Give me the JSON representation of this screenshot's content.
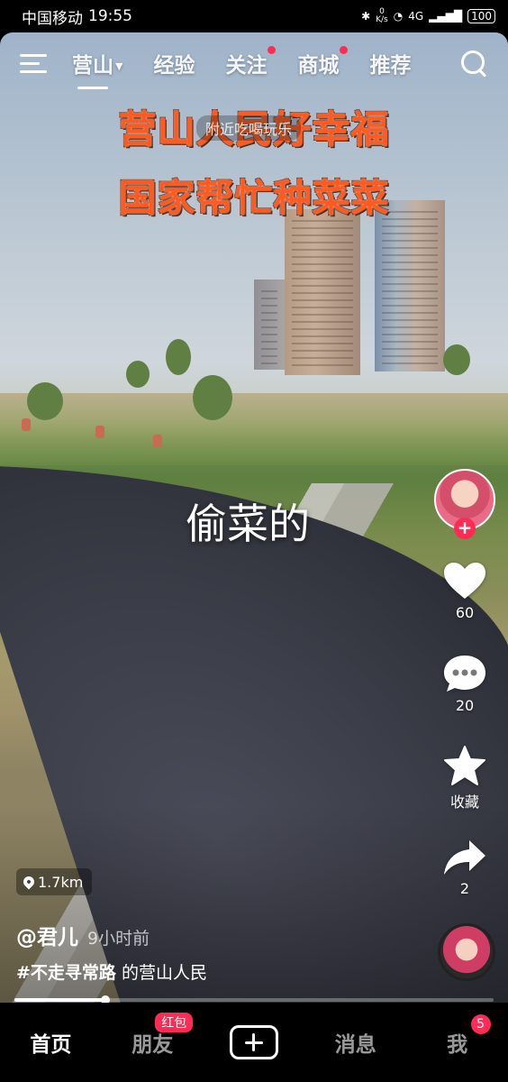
{
  "status_bar": {
    "carrier": "中国移动",
    "time": "19:55",
    "net_speed_value": "0",
    "net_speed_unit": "K/s",
    "signal": "4G",
    "battery": "100"
  },
  "top_nav": {
    "tabs": [
      {
        "label": "营山",
        "active": true,
        "has_caret": true
      },
      {
        "label": "经验"
      },
      {
        "label": "关注",
        "red_dot": true
      },
      {
        "label": "商城",
        "red_dot": true
      },
      {
        "label": "推荐"
      }
    ]
  },
  "video": {
    "title_line_1": "营山人民好幸福",
    "title_line_2": "国家帮忙种菜菜",
    "nearby_pill": "附近吃喝玩乐",
    "center_caption": "偷菜的"
  },
  "actions": {
    "likes": "60",
    "comments": "20",
    "favorite_label": "收藏",
    "shares": "2"
  },
  "meta": {
    "distance": "1.7km",
    "author": "@君儿",
    "time_ago": "9小时前",
    "hashtag": "#不走寻常路",
    "desc_rest": " 的营山人民"
  },
  "playback": {
    "progress": 0.19
  },
  "tab_bar": {
    "items": [
      {
        "label": "首页",
        "active": true
      },
      {
        "label": "朋友",
        "badge": "红包"
      },
      {
        "label": "",
        "is_plus": true
      },
      {
        "label": "消息"
      },
      {
        "label": "我",
        "badge_count": "5"
      }
    ]
  },
  "colors": {
    "accent": "#fe2c55",
    "title_orange": "#ff5a1f"
  }
}
